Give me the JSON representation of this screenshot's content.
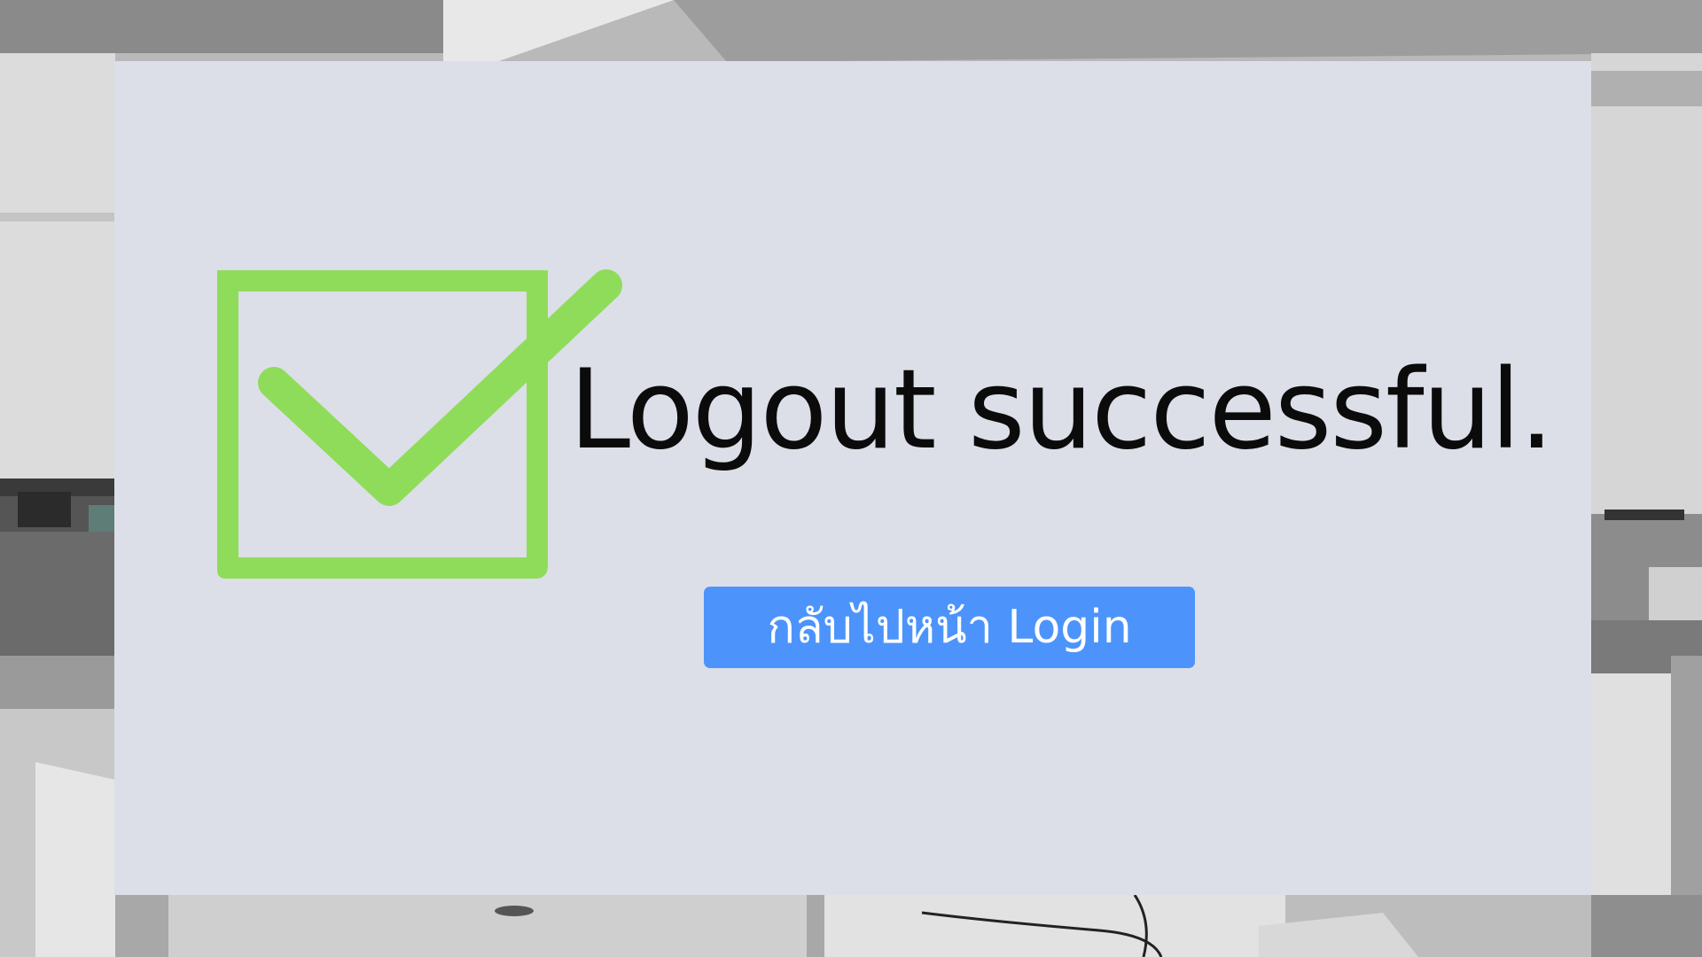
{
  "page": {
    "message": "Logout successful.",
    "status_icon": "check-box-icon",
    "login_button_label": "กลับไปหน้า Login"
  },
  "colors": {
    "card_background": "#dcdfe7",
    "check_green": "#8fdc5b",
    "button_blue": "#4c94fb",
    "button_text": "#ffffff",
    "message_text": "#0b0b0b"
  }
}
